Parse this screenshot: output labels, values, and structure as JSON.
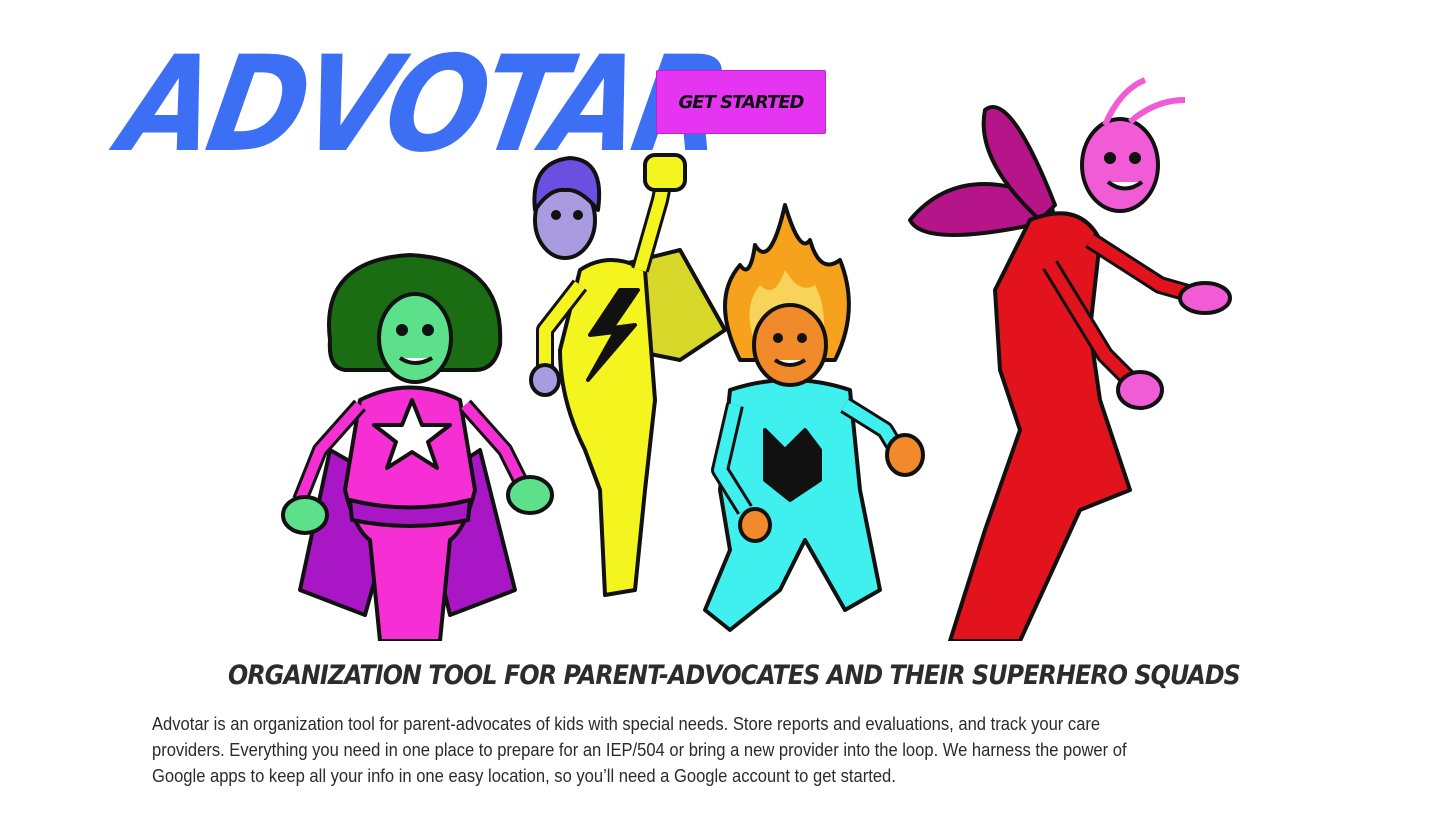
{
  "brand": {
    "logo_text": "ADVOTAR",
    "logo_color": "#3d6ff5"
  },
  "header": {
    "cta_label": "GET STARTED",
    "cta_color": "#e535f2"
  },
  "hero": {
    "characters": [
      {
        "name": "star-hero",
        "skin": "#5de08a",
        "hair": "#1a6d12",
        "suit": "#f52fd3",
        "cape": "#a816c6"
      },
      {
        "name": "lightning-hero",
        "skin": "#a89be0",
        "hair": "#6a4fe0",
        "suit": "#f4f51e"
      },
      {
        "name": "fire-hero",
        "skin": "#f08a2a",
        "hair": "#f6a21d",
        "suit": "#3ff0ef"
      },
      {
        "name": "antenna-hero",
        "skin": "#f25bd6",
        "suit": "#e3131d",
        "wings": "#b6158a"
      }
    ]
  },
  "main": {
    "tagline": "ORGANIZATION TOOL FOR PARENT-ADVOCATES AND THEIR SUPERHERO SQUADS",
    "description": "Advotar is an organization tool for parent-advocates of kids with special needs. Store reports and evaluations, and track your care providers. Everything you need in one place to prepare for an IEP/504 or bring a new provider into the loop. We harness the power of Google apps to keep all your info in one easy location, so you’ll need a Google account to get started."
  }
}
